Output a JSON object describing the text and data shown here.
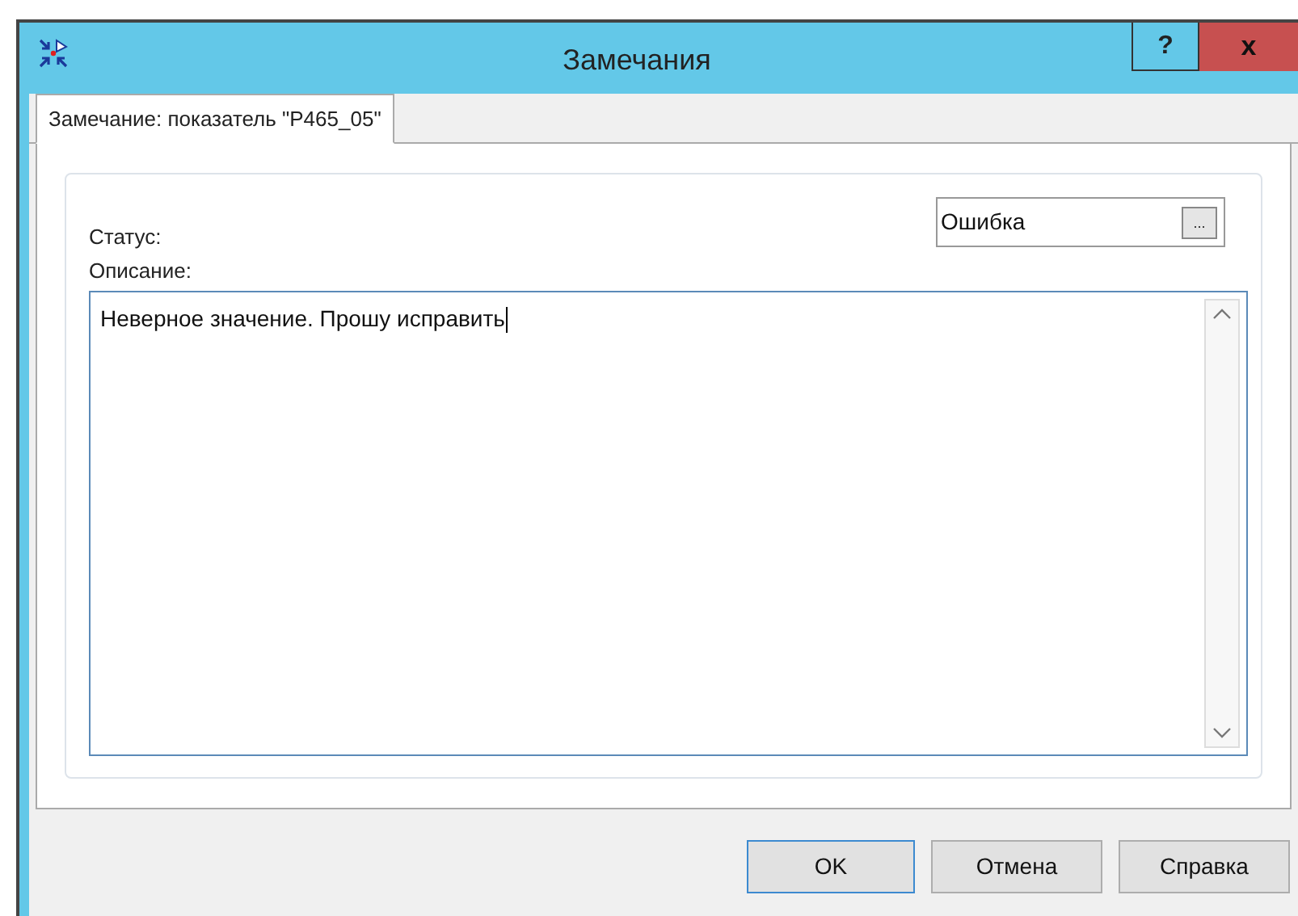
{
  "window": {
    "title": "Замечания",
    "help": "?",
    "close": "x"
  },
  "tabs": [
    {
      "label": "Замечание: показатель \"P465_05\"",
      "selected": true
    }
  ],
  "status": {
    "label": "Статус:",
    "value": "Ошибка",
    "browse": "..."
  },
  "description": {
    "label": "Описание:",
    "value": "Неверное значение. Прошу исправить"
  },
  "buttons": [
    {
      "label": "OK",
      "default": true
    },
    {
      "label": "Отмена",
      "default": false
    },
    {
      "label": "Справка",
      "default": false
    }
  ]
}
